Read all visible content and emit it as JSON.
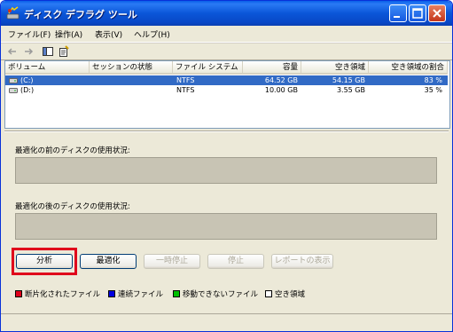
{
  "window": {
    "title": "ディスク デフラグ ツール"
  },
  "menu": [
    {
      "label": "ファイル(F)"
    },
    {
      "label": "操作(A)"
    },
    {
      "label": "表示(V)"
    },
    {
      "label": "ヘルプ(H)"
    }
  ],
  "toolbar": {
    "icons": [
      "back-arrow-icon",
      "forward-arrow-icon",
      "show-hide-console-tree-icon",
      "properties-icon"
    ]
  },
  "volumes": {
    "columns": [
      "ボリューム",
      "セッションの状態",
      "ファイル システム",
      "容量",
      "空き領域",
      "空き領域の割合"
    ],
    "rows": [
      {
        "name": "(C:)",
        "status": "",
        "fs": "NTFS",
        "capacity": "64.52 GB",
        "free": "54.15 GB",
        "free_pct": "83 %",
        "selected": true
      },
      {
        "name": "(D:)",
        "status": "",
        "fs": "NTFS",
        "capacity": "10.00 GB",
        "free": "3.55 GB",
        "free_pct": "35 %",
        "selected": false
      }
    ]
  },
  "usage": {
    "before_label": "最適化の前のディスクの使用状況:",
    "after_label": "最適化の後のディスクの使用状況:"
  },
  "buttons": {
    "analyze": "分析",
    "defragment": "最適化",
    "pause": "一時停止",
    "stop": "停止",
    "report": "レポートの表示"
  },
  "legend": [
    {
      "label": "断片化されたファイル",
      "color": "#e0001b"
    },
    {
      "label": "連続ファイル",
      "color": "#0000e0"
    },
    {
      "label": "移動できないファイル",
      "color": "#00c000"
    },
    {
      "label": "空き領域",
      "color": "#ffffff"
    }
  ]
}
